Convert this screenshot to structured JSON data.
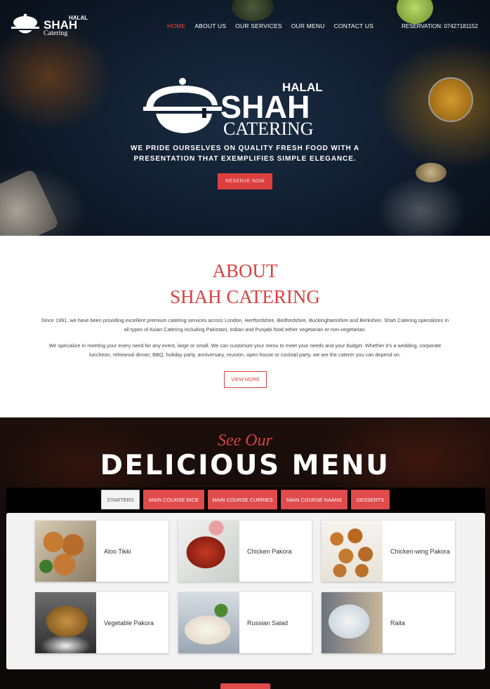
{
  "header": {
    "logo": {
      "halal": "HALAL",
      "shah": "SHAH",
      "catering": "Catering"
    },
    "nav": [
      {
        "label": "HOME",
        "active": true
      },
      {
        "label": "ABOUT US",
        "active": false
      },
      {
        "label": "OUR SERVICES",
        "active": false
      },
      {
        "label": "OUR MENU",
        "active": false
      },
      {
        "label": "CONTACT US",
        "active": false
      }
    ],
    "reservation": "RESERVATION: 07427181152"
  },
  "hero": {
    "logo": {
      "halal": "HALAL",
      "shah": "SHAH",
      "catering": "CATERING"
    },
    "tagline_line1": "WE PRIDE OURSELVES ON QUALITY FRESH FOOD WITH A",
    "tagline_line2": "PRESENTATION THAT EXEMPLIFIES SIMPLE ELEGANCE.",
    "reserve_button": "RESERVE NOW"
  },
  "about": {
    "title_line1": "ABOUT",
    "title_line2": "SHAH CATERING",
    "paragraph1_line1": "Since 1991, we have been providing excellent premium catering services across London, Hertfordshire, Bedfordshire, Buckinghamshire and Berkshire. Shah Catering specializes in",
    "paragraph1_line2": "all types of Asian Catering including Pakistani, Indian and Punjabi food either vegetarian or non-vegetarian.",
    "paragraph2_line1": "We specialize in meeting your every need for any event, large or small. We can customize your menu to meet your needs and your budget. Whether it's a wedding, corporate",
    "paragraph2_line2": "luncheon, rehearsal dinner, BBQ, holiday party, anniversary, reunion, open house or cocktail party, we are the caterer you can depend on.",
    "view_more_button": "VIEW MORE"
  },
  "menu": {
    "script_title": "See Our",
    "title": "DELICIOUS MENU",
    "tabs": [
      {
        "label": "STARTERS",
        "active": true
      },
      {
        "label": "MAIN COURSE RICE",
        "active": false
      },
      {
        "label": "MAIN COURSE CURRIES",
        "active": false
      },
      {
        "label": "MAIN COURSE NAANS",
        "active": false
      },
      {
        "label": "DESSERTS",
        "active": false
      }
    ],
    "items": [
      {
        "name": "Aloo Tikki"
      },
      {
        "name": "Chicken Pakora"
      },
      {
        "name": "Chicken-wing Pakora"
      },
      {
        "name": "Vegetable Pakora"
      },
      {
        "name": "Russian Salad"
      },
      {
        "name": "Raita"
      }
    ]
  },
  "colors": {
    "accent": "#e04b4b",
    "hero_bg": "#101d2e",
    "text": "#444444"
  }
}
